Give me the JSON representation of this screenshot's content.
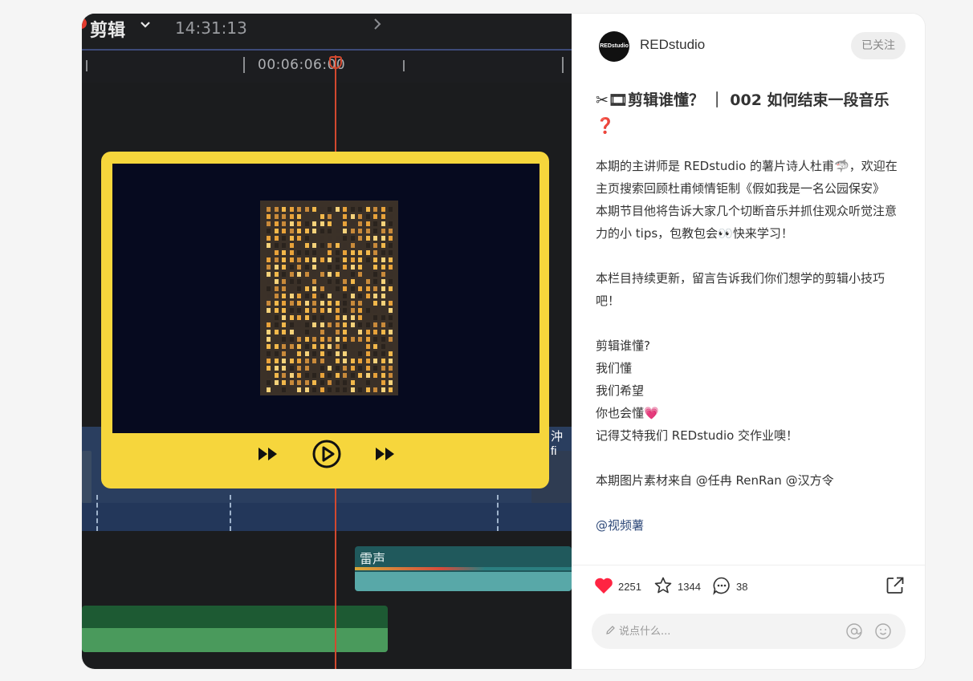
{
  "video": {
    "app_title": "剪辑",
    "clock": "14:31:13",
    "timecode": "00:06:06:00",
    "audio_clip_label": "雷声",
    "overlay_text": "沖 fi"
  },
  "author": {
    "avatar_text": "REDstudio",
    "name": "REDstudio",
    "follow_label": "已关注"
  },
  "note": {
    "title": "✂🎞剪辑谁懂？ ｜ 002 如何结束一段音乐❓",
    "paragraphs": [
      "本期的主讲师是 REDstudio 的薯片诗人杜甫🦈，欢迎在主页搜索回顾杜甫倾情钜制《假如我是一名公园保安》",
      "本期节目他将告诉大家几个切断音乐并抓住观众听觉注意力的小 tips，包教包会👀快来学习！",
      "",
      "本栏目持续更新，留言告诉我们你们想学的剪辑小技巧吧！",
      "",
      "剪辑谁懂?",
      "我们懂",
      "我们希望",
      "你也会懂💗",
      "记得艾特我们 REDstudio 交作业噢！",
      "",
      "本期图片素材来自 @任冉 RenRan @汉方令",
      "",
      "@视频薯"
    ]
  },
  "interactions": {
    "likes": "2251",
    "collects": "1344",
    "comments": "38"
  },
  "comment_box": {
    "placeholder": "说点什么..."
  },
  "colors": {
    "like": "#ff2442",
    "player_frame": "#f6d63c",
    "mention": "#2f4a7a"
  }
}
